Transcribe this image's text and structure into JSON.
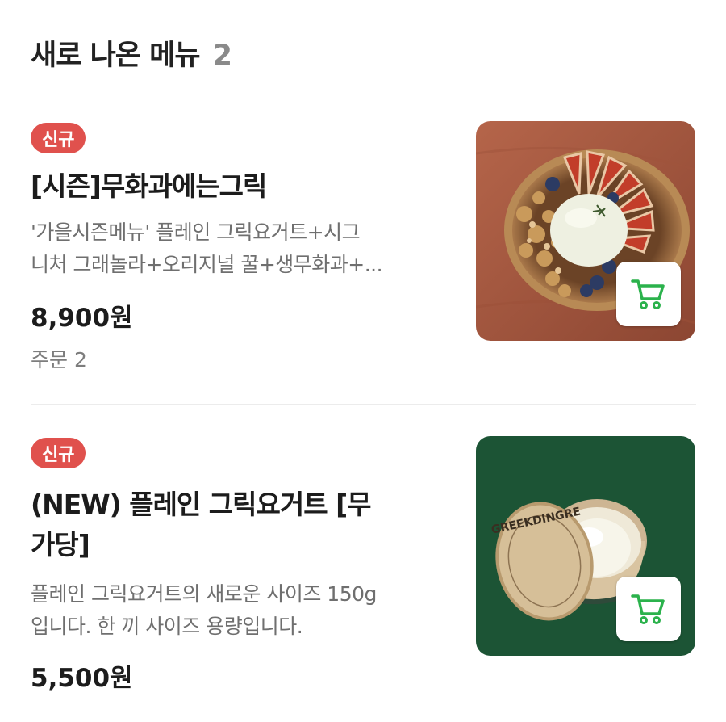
{
  "section": {
    "title": "새로 나온 메뉴",
    "count": "2"
  },
  "items": [
    {
      "badge": "신규",
      "title": "[시즌]무화과에는그릭",
      "desc_line1": "'가을시즌메뉴' 플레인 그릭요거트+시그",
      "desc_line2": "니처 그래놀라+오리지널 꿀+생무화과+...",
      "price": "8,900원",
      "orders": "주문 2",
      "image_icon": "fig-yogurt-bowl-photo",
      "cart_icon": "cart-icon"
    },
    {
      "badge": "신규",
      "title_line1": "(NEW) 플레인 그릭요거트 [무",
      "title_line2": "가당]",
      "desc_line1": "플레인 그릭요거트의 새로운 사이즈 150g",
      "desc_line2": "입니다. 한 끼 사이즈 용량입니다.",
      "price": "5,500원",
      "image_icon": "greek-yogurt-cup-photo",
      "cart_icon": "cart-icon"
    }
  ],
  "brand_text": "GREEKDINGRE",
  "colors": {
    "badge": "#e0514d",
    "cart_green": "#2bb24c",
    "item2_bg": "#1f5a3a"
  }
}
